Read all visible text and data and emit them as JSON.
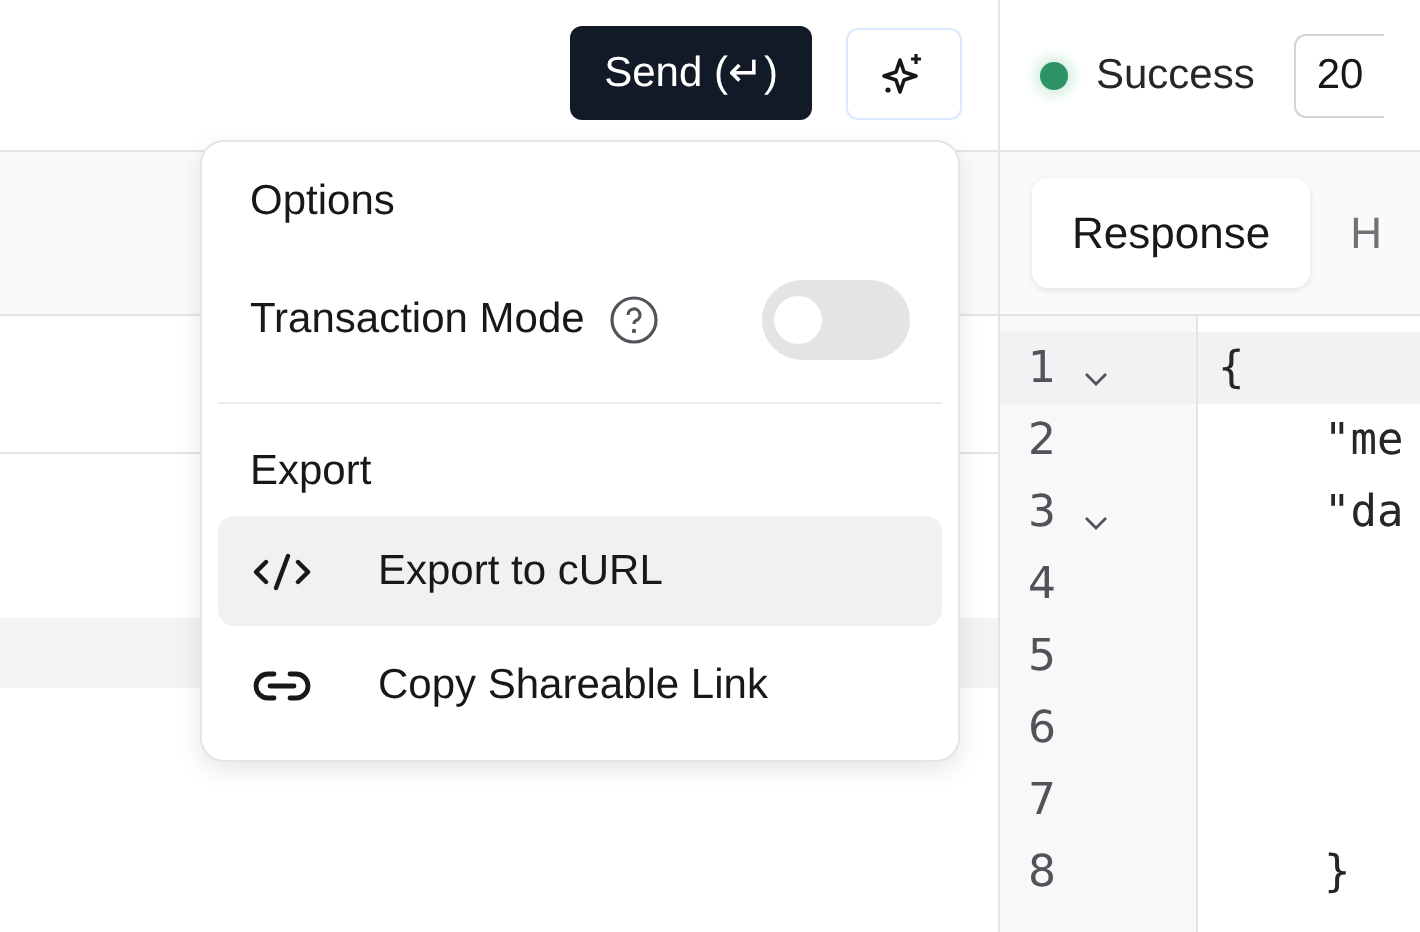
{
  "toolbar": {
    "send_button": "Send (↵)"
  },
  "status": {
    "label": "Success",
    "color": "#2e9467",
    "code": "20"
  },
  "response_tabs": [
    {
      "label": "Response",
      "selected": true
    },
    {
      "label": "H",
      "selected": false
    }
  ],
  "editor": {
    "lines": [
      {
        "number": "1",
        "foldable": true,
        "active": true,
        "text": "{"
      },
      {
        "number": "2",
        "foldable": false,
        "active": false,
        "text": "    \"me"
      },
      {
        "number": "3",
        "foldable": true,
        "active": false,
        "text": "    \"da"
      },
      {
        "number": "4",
        "foldable": false,
        "active": false
      },
      {
        "number": "5",
        "foldable": false,
        "active": false
      },
      {
        "number": "6",
        "foldable": false,
        "active": false
      },
      {
        "number": "7",
        "foldable": false,
        "active": false
      },
      {
        "number": "8",
        "foldable": false,
        "active": false,
        "text": "    }"
      }
    ]
  },
  "menu": {
    "sections": [
      {
        "title": "Options",
        "items": [
          {
            "kind": "toggle",
            "label": "Transaction Mode",
            "help": true,
            "on": false
          }
        ]
      },
      {
        "title": "Export",
        "items": [
          {
            "kind": "action",
            "label": "Export to cURL",
            "selected": true
          },
          {
            "kind": "action",
            "label": "Copy Shareable Link",
            "selected": false
          }
        ]
      }
    ]
  }
}
